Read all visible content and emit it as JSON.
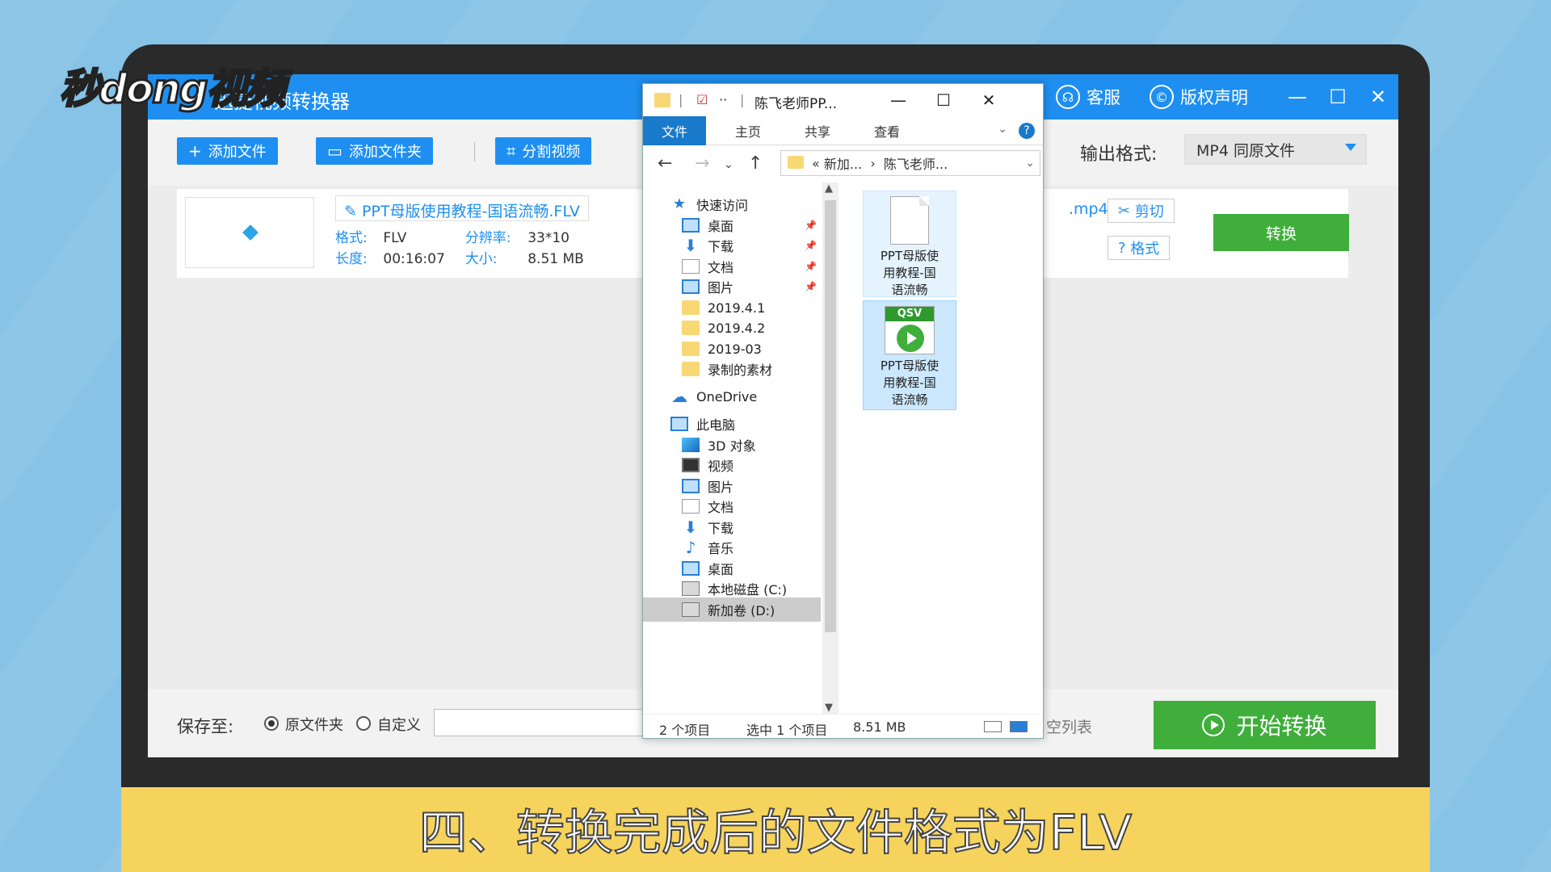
{
  "watermark": {
    "text": "秒dong视频"
  },
  "app": {
    "title": "迅捷视频转换器",
    "title_right": {
      "service": "客服",
      "copyright": "版权声明"
    },
    "toolbar": {
      "add_file": "添加文件",
      "add_folder": "添加文件夹",
      "split_video": "分割视频",
      "output_format_label": "输出格式:",
      "output_format_value": "MP4  同原文件"
    },
    "file_row": {
      "file_name": "PPT母版使用教程-国语流畅.FLV",
      "format_label": "格式:",
      "format_value": "FLV",
      "resolution_label": "分辨率:",
      "resolution_value": "33*10",
      "duration_label": "长度:",
      "duration_value": "00:16:07",
      "size_label": "大小:",
      "size_value": "8.51 MB",
      "output_ext": ".mp4",
      "cut_label": "剪切",
      "format_btn_label": "格式",
      "convert_label": "转换"
    },
    "bottom": {
      "save_to_label": "保存至:",
      "opt_original": "原文件夹",
      "opt_custom": "自定义",
      "clear_list": "空列表",
      "start_convert": "开始转换"
    }
  },
  "explorer": {
    "title": "陈飞老师PP...",
    "ribbon_tabs": [
      "文件",
      "主页",
      "共享",
      "查看"
    ],
    "address": {
      "part1": "新加...",
      "part2": "陈飞老师..."
    },
    "nav_items": [
      {
        "label": "快速访问"
      },
      {
        "label": "桌面"
      },
      {
        "label": "下载"
      },
      {
        "label": "文档"
      },
      {
        "label": "图片"
      },
      {
        "label": "2019.4.1"
      },
      {
        "label": "2019.4.2"
      },
      {
        "label": "2019-03"
      },
      {
        "label": "录制的素材"
      },
      {
        "label": "OneDrive"
      },
      {
        "label": "此电脑"
      },
      {
        "label": "3D 对象"
      },
      {
        "label": "视频"
      },
      {
        "label": "图片"
      },
      {
        "label": "文档"
      },
      {
        "label": "下载"
      },
      {
        "label": "音乐"
      },
      {
        "label": "桌面"
      },
      {
        "label": "本地磁盘 (C:)"
      },
      {
        "label": "新加卷 (D:)"
      }
    ],
    "files": [
      {
        "name_l1": "PPT母版使",
        "name_l2": "用教程-国",
        "name_l3": "语流畅"
      },
      {
        "badge": "QSV",
        "name_l1": "PPT母版使",
        "name_l2": "用教程-国",
        "name_l3": "语流畅"
      }
    ],
    "status": {
      "count": "2 个项目",
      "selected": "选中 1 个项目",
      "size": "8.51 MB"
    }
  },
  "caption": {
    "text": "四、转换完成后的文件格式为FLV"
  },
  "colors": {
    "app_blue": "#1e8ff0",
    "green": "#3fae3b",
    "caption_bg": "#f6d35c",
    "backdrop": "#86c3e6"
  }
}
